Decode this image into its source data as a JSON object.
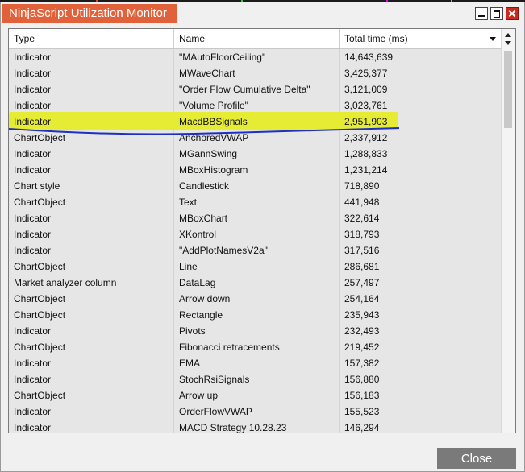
{
  "window": {
    "title": "NinjaScript Utilization Monitor"
  },
  "columns": {
    "type": "Type",
    "name": "Name",
    "total_time": "Total time (ms)"
  },
  "rows": [
    {
      "type": "Indicator",
      "name": " \"MAutoFloorCeiling\"",
      "time": "14,643,639"
    },
    {
      "type": "Indicator",
      "name": "MWaveChart",
      "time": "3,425,377"
    },
    {
      "type": "Indicator",
      "name": " \"Order Flow Cumulative Delta\"",
      "time": "3,121,009"
    },
    {
      "type": "Indicator",
      "name": " \"Volume Profile\"",
      "time": "3,023,761"
    },
    {
      "type": "Indicator",
      "name": "MacdBBSignals",
      "time": "2,951,903"
    },
    {
      "type": "ChartObject",
      "name": "AnchoredVWAP",
      "time": "2,337,912"
    },
    {
      "type": "Indicator",
      "name": "MGannSwing",
      "time": "1,288,833"
    },
    {
      "type": "Indicator",
      "name": "MBoxHistogram",
      "time": "1,231,214"
    },
    {
      "type": "Chart style",
      "name": "Candlestick",
      "time": "718,890"
    },
    {
      "type": "ChartObject",
      "name": "Text",
      "time": "441,948"
    },
    {
      "type": "Indicator",
      "name": "MBoxChart",
      "time": "322,614"
    },
    {
      "type": "Indicator",
      "name": "XKontrol",
      "time": "318,793"
    },
    {
      "type": "Indicator",
      "name": "\"AddPlotNamesV2a\"",
      "time": "317,516"
    },
    {
      "type": "ChartObject",
      "name": "Line",
      "time": "286,681"
    },
    {
      "type": "Market analyzer column",
      "name": "DataLag",
      "time": "257,497"
    },
    {
      "type": "ChartObject",
      "name": "Arrow down",
      "time": "254,164"
    },
    {
      "type": "ChartObject",
      "name": "Rectangle",
      "time": "235,943"
    },
    {
      "type": "Indicator",
      "name": "Pivots",
      "time": "232,493"
    },
    {
      "type": "ChartObject",
      "name": "Fibonacci retracements",
      "time": "219,452"
    },
    {
      "type": "Indicator",
      "name": "EMA",
      "time": "157,382"
    },
    {
      "type": "Indicator",
      "name": "StochRsiSignals",
      "time": "156,880"
    },
    {
      "type": "ChartObject",
      "name": "Arrow up",
      "time": "156,183"
    },
    {
      "type": "Indicator",
      "name": "OrderFlowVWAP",
      "time": "155,523"
    },
    {
      "type": "Indicator",
      "name": "MACD Strategy 10.28.23",
      "time": "146,294"
    }
  ],
  "footer": {
    "close_label": "Close"
  },
  "colors": {
    "title_bar": "#e0613a",
    "highlight": "#e6ec00",
    "annotation_line": "#1f2fc0",
    "close_button": "#7a7a7a"
  },
  "icons": [
    "minimize-icon",
    "maximize-icon",
    "close-icon",
    "sort-caret-icon",
    "scroll-up-icon",
    "scroll-down-icon"
  ]
}
